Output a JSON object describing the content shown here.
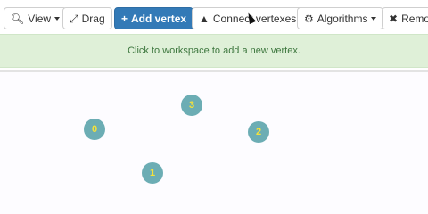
{
  "toolbar": {
    "view_label": "View",
    "drag_label": "Drag",
    "add_vertex_label": "Add vertex",
    "connect_label": "Connect vertexes",
    "algorithms_label": "Algorithms",
    "remove_label": "Remo",
    "icons": {
      "view": "zoom-icon",
      "drag": "move-arrows-icon",
      "add_vertex": "plus-icon",
      "connect": "road-icon",
      "algorithms": "gear-icon",
      "remove": "x-icon"
    }
  },
  "info": {
    "message": "Click to workspace to add a new vertex."
  },
  "graph": {
    "vertices": [
      {
        "label": "0"
      },
      {
        "label": "1"
      },
      {
        "label": "2"
      },
      {
        "label": "3"
      }
    ]
  },
  "colors": {
    "primary": "#337ab7",
    "info_bg": "#dff0d8",
    "info_text": "#3c763d",
    "vertex_fill": "#6cadb4",
    "vertex_text": "#f5e23a"
  }
}
